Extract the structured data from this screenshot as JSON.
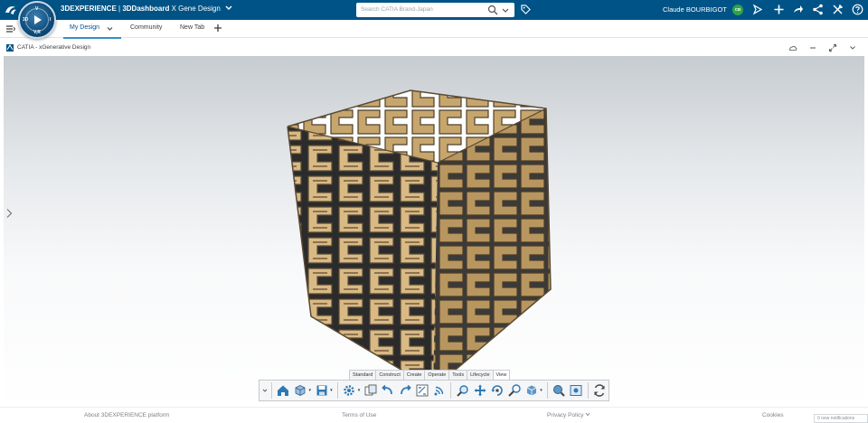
{
  "topbar": {
    "brand": "3DEXPERIENCE",
    "separator": " | ",
    "app": "3DDashboard",
    "dashboard_name": "X Gene Design",
    "search_placeholder": "Search CATIA Brand-Japan",
    "user_name": "Claude BOURBIGOT",
    "user_initials": "CB",
    "compass_quadrants": {
      "north": "V",
      "south": "V,R",
      "east": "I",
      "west": "3D"
    },
    "icons": [
      "share-icon",
      "add-icon",
      "forward-icon",
      "network-icon",
      "tools-icon",
      "help-icon"
    ]
  },
  "tabs": [
    {
      "label": "My Design",
      "active": true
    },
    {
      "label": "Community",
      "active": false
    },
    {
      "label": "New Tab",
      "active": false
    }
  ],
  "widget": {
    "title": "CATIA - xGenerative Design"
  },
  "action_bar": {
    "tabs": [
      {
        "label": "Standard",
        "active": false
      },
      {
        "label": "Construct",
        "active": false
      },
      {
        "label": "Create",
        "active": false
      },
      {
        "label": "Operate",
        "active": false
      },
      {
        "label": "Tools",
        "active": false
      },
      {
        "label": "Lifecycle",
        "active": false
      },
      {
        "label": "View",
        "active": true
      }
    ],
    "tools": [
      "home-view-icon",
      "view-cube-icon",
      "save-icon",
      "gear-settings-icon",
      "compare-icon",
      "undo-icon",
      "redo-icon",
      "measure-icon",
      "broadcast-icon",
      "zoom-icon",
      "pan-icon",
      "rotate-icon",
      "zoom-area-icon",
      "render-style-icon",
      "magnifier-icon",
      "capture-icon",
      "refresh-icon"
    ]
  },
  "footer": {
    "about": "About 3DEXPERIENCE platform",
    "terms": "Terms of Use",
    "privacy": "Privacy Policy",
    "cookies": "Cookies",
    "notifications": "0 new notifications"
  },
  "colors": {
    "topbar": "#005386",
    "accent": "#368ec4",
    "model_wood": "#d9ba85",
    "model_shadow": "#8c7350"
  }
}
